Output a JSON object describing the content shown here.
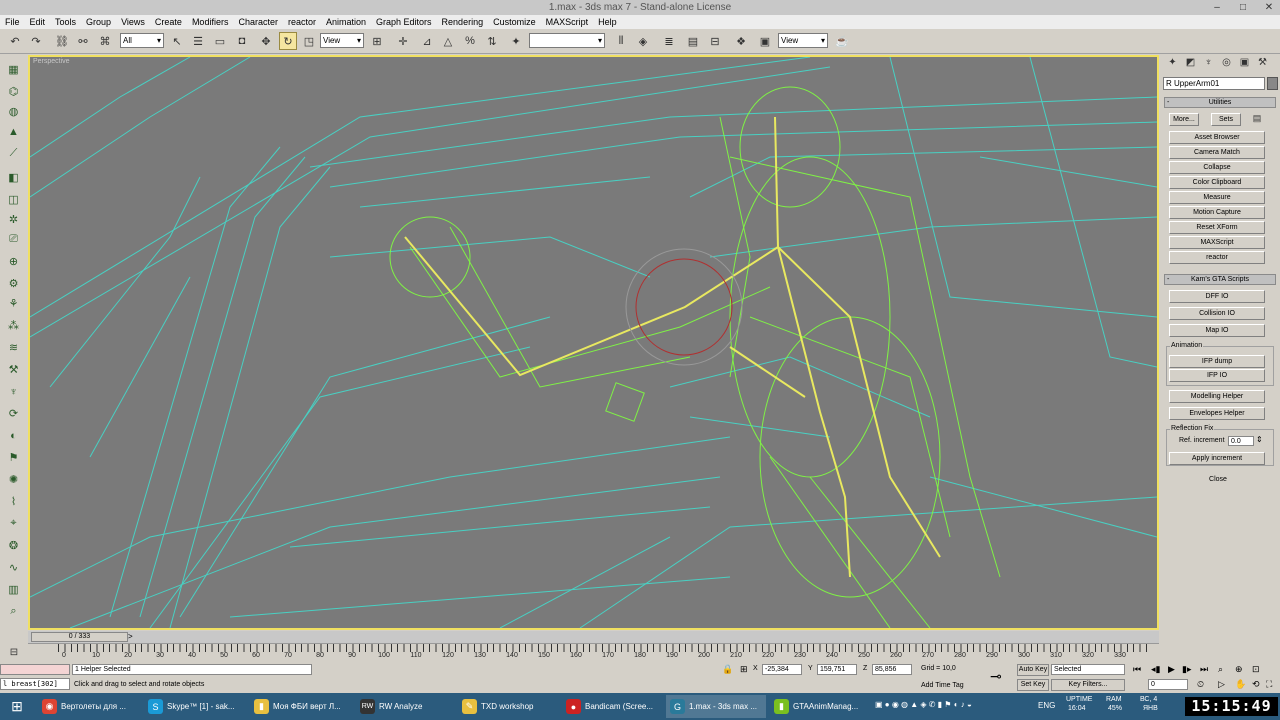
{
  "window": {
    "title": "1.max - 3ds max 7 - Stand-alone License"
  },
  "menu": [
    "File",
    "Edit",
    "Tools",
    "Group",
    "Views",
    "Create",
    "Modifiers",
    "Character",
    "reactor",
    "Animation",
    "Graph Editors",
    "Rendering",
    "Customize",
    "MAXScript",
    "Help"
  ],
  "toolbar": {
    "selection_filter": "All",
    "ref_coord": "View",
    "named_selection": "",
    "render_view": "View"
  },
  "viewport": {
    "label": "Perspective"
  },
  "command_panel": {
    "object_name": "R UpperArm01",
    "utilities_header": "Utilities",
    "more_label": "More...",
    "sets_label": "Sets",
    "utilities": [
      "Asset Browser",
      "Camera Match",
      "Collapse",
      "Color Clipboard",
      "Measure",
      "Motion Capture",
      "Reset XForm",
      "MAXScript",
      "reactor"
    ],
    "gta_header": "Kam's GTA Scripts",
    "gta_buttons": [
      "DFF IO",
      "Collision IO",
      "Map IO"
    ],
    "animation_group": "Animation",
    "animation_buttons": [
      "IFP dump",
      "IFP IO"
    ],
    "modelling_helper": "Modelling Helper",
    "envelopes_helper": "Envelopes Helper",
    "reflection_group": "Reflection Fix",
    "ref_increment_label": "Ref. increment",
    "ref_increment_value": "0.0",
    "apply_increment": "Apply increment",
    "close": "Close"
  },
  "timeslider": {
    "position": "0 / 333"
  },
  "ruler_labels": [
    "0",
    "10",
    "20",
    "30",
    "40",
    "50",
    "60",
    "70",
    "80",
    "90",
    "100",
    "110",
    "120",
    "130",
    "140",
    "150",
    "160",
    "170",
    "180",
    "190",
    "200",
    "210",
    "220",
    "230",
    "240",
    "250",
    "260",
    "270",
    "280",
    "290",
    "300",
    "310",
    "320",
    "330"
  ],
  "status": {
    "selection": "1 Helper Selected",
    "prompt": "Click and drag to select and rotate objects",
    "maxscript_listener": "l breast[302]",
    "x_value": "-25,384",
    "y_value": "159,751",
    "z_value": "85,856",
    "x_label": "X",
    "y_label": "Y",
    "z_label": "Z",
    "grid": "Grid = 10,0",
    "add_time_tag": "Add Time Tag",
    "auto_key": "Auto Key",
    "set_key": "Set Key",
    "key_mode": "Selected",
    "key_filters": "Key Filters...",
    "frame": "0"
  },
  "taskbar": {
    "tasks": [
      {
        "label": "Вертолеты для ...",
        "color": "#dd4433",
        "glyph": "◉"
      },
      {
        "label": "Skype™ [1] - sak...",
        "color": "#1a9ad6",
        "glyph": "S"
      },
      {
        "label": "Моя ФБИ верт Л...",
        "color": "#e8c040",
        "glyph": "▮"
      },
      {
        "label": "RW Analyze",
        "color": "#333333",
        "glyph": "RW"
      },
      {
        "label": "TXD workshop",
        "color": "#e8c040",
        "glyph": "✎"
      },
      {
        "label": "Bandicam (Scree...",
        "color": "#cc2222",
        "glyph": "●"
      },
      {
        "label": "1.max - 3ds max ...",
        "color": "#2a7a9a",
        "glyph": "G"
      },
      {
        "label": "GTAAnimManag...",
        "color": "#7ac020",
        "glyph": "▮"
      }
    ],
    "lang": "ENG",
    "uptime_label": "UPTIME",
    "uptime": "16:04",
    "ram_label": "RAM",
    "ram": "45%",
    "date_top": "ВС, 4",
    "date_bottom": "ЯНВ",
    "clock": "15:15:49"
  },
  "colors": {
    "viewport_bg": "#7a7a7a",
    "wire_cyan": "#40e0d0",
    "wire_green": "#80ff40",
    "bone_yellow": "#e8e860",
    "active_border": "#f0e060"
  }
}
